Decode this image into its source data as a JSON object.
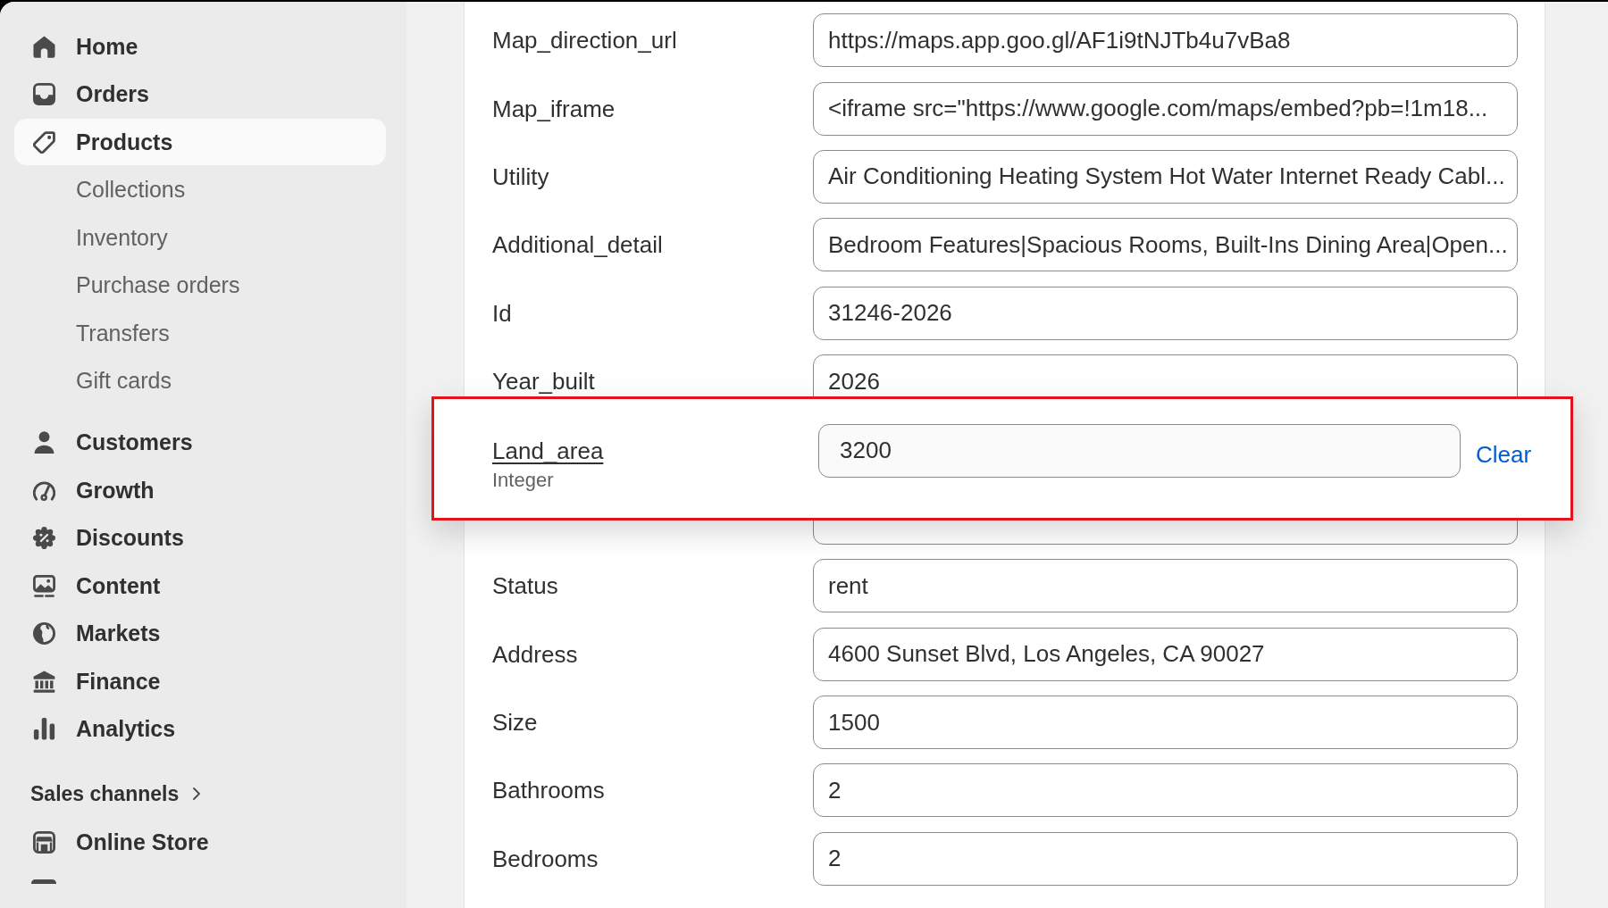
{
  "sidebar": {
    "items": [
      {
        "label": "Home",
        "selected": false
      },
      {
        "label": "Orders",
        "selected": false
      },
      {
        "label": "Products",
        "selected": true,
        "children": [
          {
            "label": "Collections",
            "selected": false
          },
          {
            "label": "Inventory",
            "selected": false
          },
          {
            "label": "Purchase orders",
            "selected": false
          },
          {
            "label": "Transfers",
            "selected": false
          },
          {
            "label": "Gift cards",
            "selected": false
          }
        ]
      },
      {
        "label": "Customers",
        "selected": false
      },
      {
        "label": "Growth",
        "selected": false
      },
      {
        "label": "Discounts",
        "selected": false
      },
      {
        "label": "Content",
        "selected": false
      },
      {
        "label": "Markets",
        "selected": false
      },
      {
        "label": "Finance",
        "selected": false
      },
      {
        "label": "Analytics",
        "selected": false
      }
    ],
    "sales_channels": {
      "heading": "Sales channels",
      "items": [
        {
          "label": "Online Store",
          "selected": false
        }
      ]
    }
  },
  "form": {
    "fields": [
      {
        "kind": "text",
        "label": "Map_direction_url",
        "value": "https://maps.app.goo.gl/AF1i9tNJTb4u7vBa8"
      },
      {
        "kind": "text",
        "label": "Map_iframe",
        "value": "<iframe src=\"https://www.google.com/maps/embed?pb=!1m18..."
      },
      {
        "kind": "text",
        "label": "Utility",
        "value": "Air Conditioning Heating System Hot Water Internet Ready Cabl..."
      },
      {
        "kind": "text",
        "label": "Additional_detail",
        "value": "Bedroom Features|Spacious Rooms, Built-Ins Dining Area|Open..."
      },
      {
        "kind": "text",
        "label": "Id",
        "value": "31246-2026"
      },
      {
        "kind": "text",
        "label": "Year_built",
        "value": "2026"
      },
      {
        "kind": "floating",
        "label": "Land_area",
        "type": "Integer",
        "value": "3200",
        "action": "Clear"
      },
      {
        "kind": "covered"
      },
      {
        "kind": "text",
        "label": "Status",
        "value": "rent"
      },
      {
        "kind": "text",
        "label": "Address",
        "value": "4600 Sunset Blvd, Los Angeles, CA 90027"
      },
      {
        "kind": "text",
        "label": "Size",
        "value": "1500"
      },
      {
        "kind": "text",
        "label": "Bathrooms",
        "value": "2"
      },
      {
        "kind": "text",
        "label": "Bedrooms",
        "value": "2"
      }
    ]
  }
}
